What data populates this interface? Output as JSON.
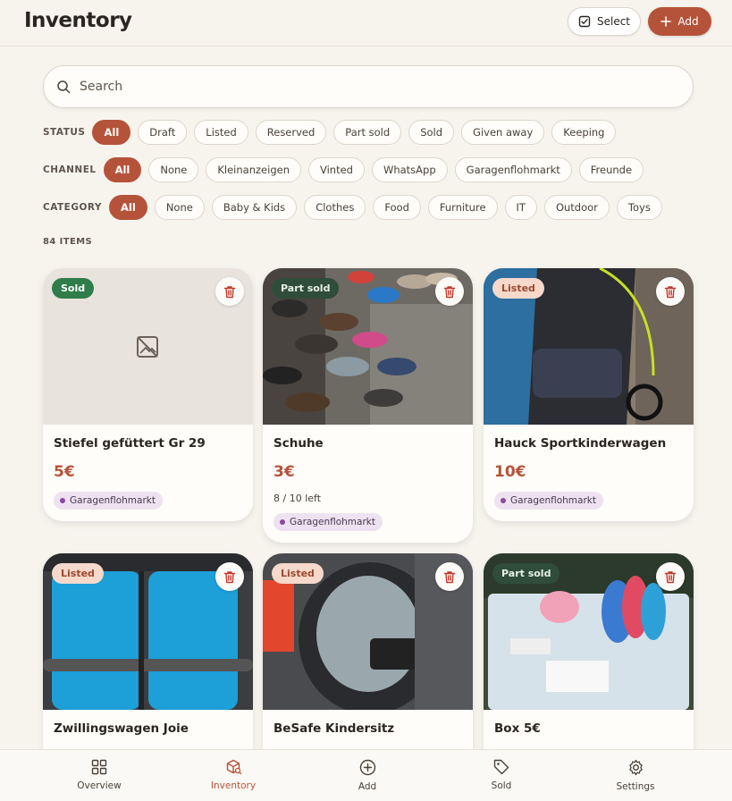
{
  "header": {
    "title": "Inventory",
    "select_label": "Select",
    "add_label": "Add"
  },
  "search": {
    "placeholder": "Search",
    "value": ""
  },
  "filters": {
    "status": {
      "label": "STATUS",
      "options": [
        "All",
        "Draft",
        "Listed",
        "Reserved",
        "Part sold",
        "Sold",
        "Given away",
        "Keeping"
      ],
      "selected": "All"
    },
    "channel": {
      "label": "CHANNEL",
      "options": [
        "All",
        "None",
        "Kleinanzeigen",
        "Vinted",
        "WhatsApp",
        "Garagenflohmarkt",
        "Freunde"
      ],
      "selected": "All"
    },
    "category": {
      "label": "CATEGORY",
      "options": [
        "All",
        "None",
        "Baby & Kids",
        "Clothes",
        "Food",
        "Furniture",
        "IT",
        "Outdoor",
        "Toys"
      ],
      "selected": "All"
    }
  },
  "item_count": "84 ITEMS",
  "items": [
    {
      "name": "Stiefel gefüttert Gr 29",
      "price": "5€",
      "status": "Sold",
      "channel": "Garagenflohmarkt",
      "image": "no-image-icon"
    },
    {
      "name": "Schuhe",
      "price": "3€",
      "status": "Part sold",
      "quantity_left": "8 / 10 left",
      "channel": "Garagenflohmarkt",
      "image": "shoes-photo"
    },
    {
      "name": "Hauck Sportkinderwagen",
      "price": "10€",
      "status": "Listed",
      "channel": "Garagenflohmarkt",
      "image": "stroller-photo"
    },
    {
      "name": "Zwillingswagen Joie",
      "status": "Listed",
      "image": "twin-stroller-photo"
    },
    {
      "name": "BeSafe Kindersitz",
      "status": "Listed",
      "image": "car-seat-photo"
    },
    {
      "name": "Box 5€",
      "status": "Part sold",
      "image": "toy-box-photo"
    }
  ],
  "nav": {
    "items": [
      {
        "label": "Overview",
        "icon": "grid-icon"
      },
      {
        "label": "Inventory",
        "icon": "box-search-icon",
        "active": true
      },
      {
        "label": "Add",
        "icon": "plus-circle-icon"
      },
      {
        "label": "Sold",
        "icon": "tag-icon"
      },
      {
        "label": "Settings",
        "icon": "gear-icon"
      }
    ]
  },
  "colors": {
    "accent": "#b5533a",
    "background": "#f7f4ee",
    "sold_badge": "#2e7d4a",
    "listed_badge": "#f6d9cb",
    "channel_tag": "#eee2f1"
  }
}
